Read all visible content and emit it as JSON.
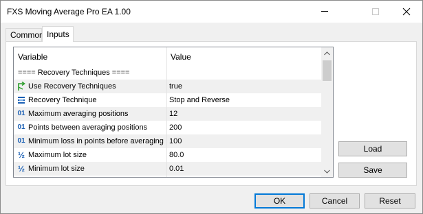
{
  "window": {
    "title": "FXS Moving Average Pro EA 1.00"
  },
  "tabs": [
    {
      "label": "Common"
    },
    {
      "label": "Inputs"
    }
  ],
  "grid": {
    "headers": {
      "variable": "Variable",
      "value": "Value"
    },
    "rows": [
      {
        "variable": "==== Recovery Techniques ====",
        "value": "",
        "icon": "",
        "section": true
      },
      {
        "variable": "Use Recovery Techniques",
        "value": "true",
        "icon": "green-arrow-icon"
      },
      {
        "variable": "Recovery Technique",
        "value": "Stop and Reverse",
        "icon": "enum-list-icon"
      },
      {
        "variable": "Maximum averaging positions",
        "value": "12",
        "icon": "integer-icon"
      },
      {
        "variable": "Points between averaging positions",
        "value": "200",
        "icon": "integer-icon"
      },
      {
        "variable": "Minimum loss in points before averaging",
        "value": "100",
        "icon": "integer-icon"
      },
      {
        "variable": "Maximum lot size",
        "value": "80.0",
        "icon": "double-icon"
      },
      {
        "variable": "Minimum lot size",
        "value": "0.01",
        "icon": "double-icon"
      }
    ]
  },
  "buttons": {
    "load": "Load",
    "save": "Save",
    "ok": "OK",
    "cancel": "Cancel",
    "reset": "Reset"
  },
  "icon_glyphs": {
    "integer": "01",
    "double": "½"
  }
}
